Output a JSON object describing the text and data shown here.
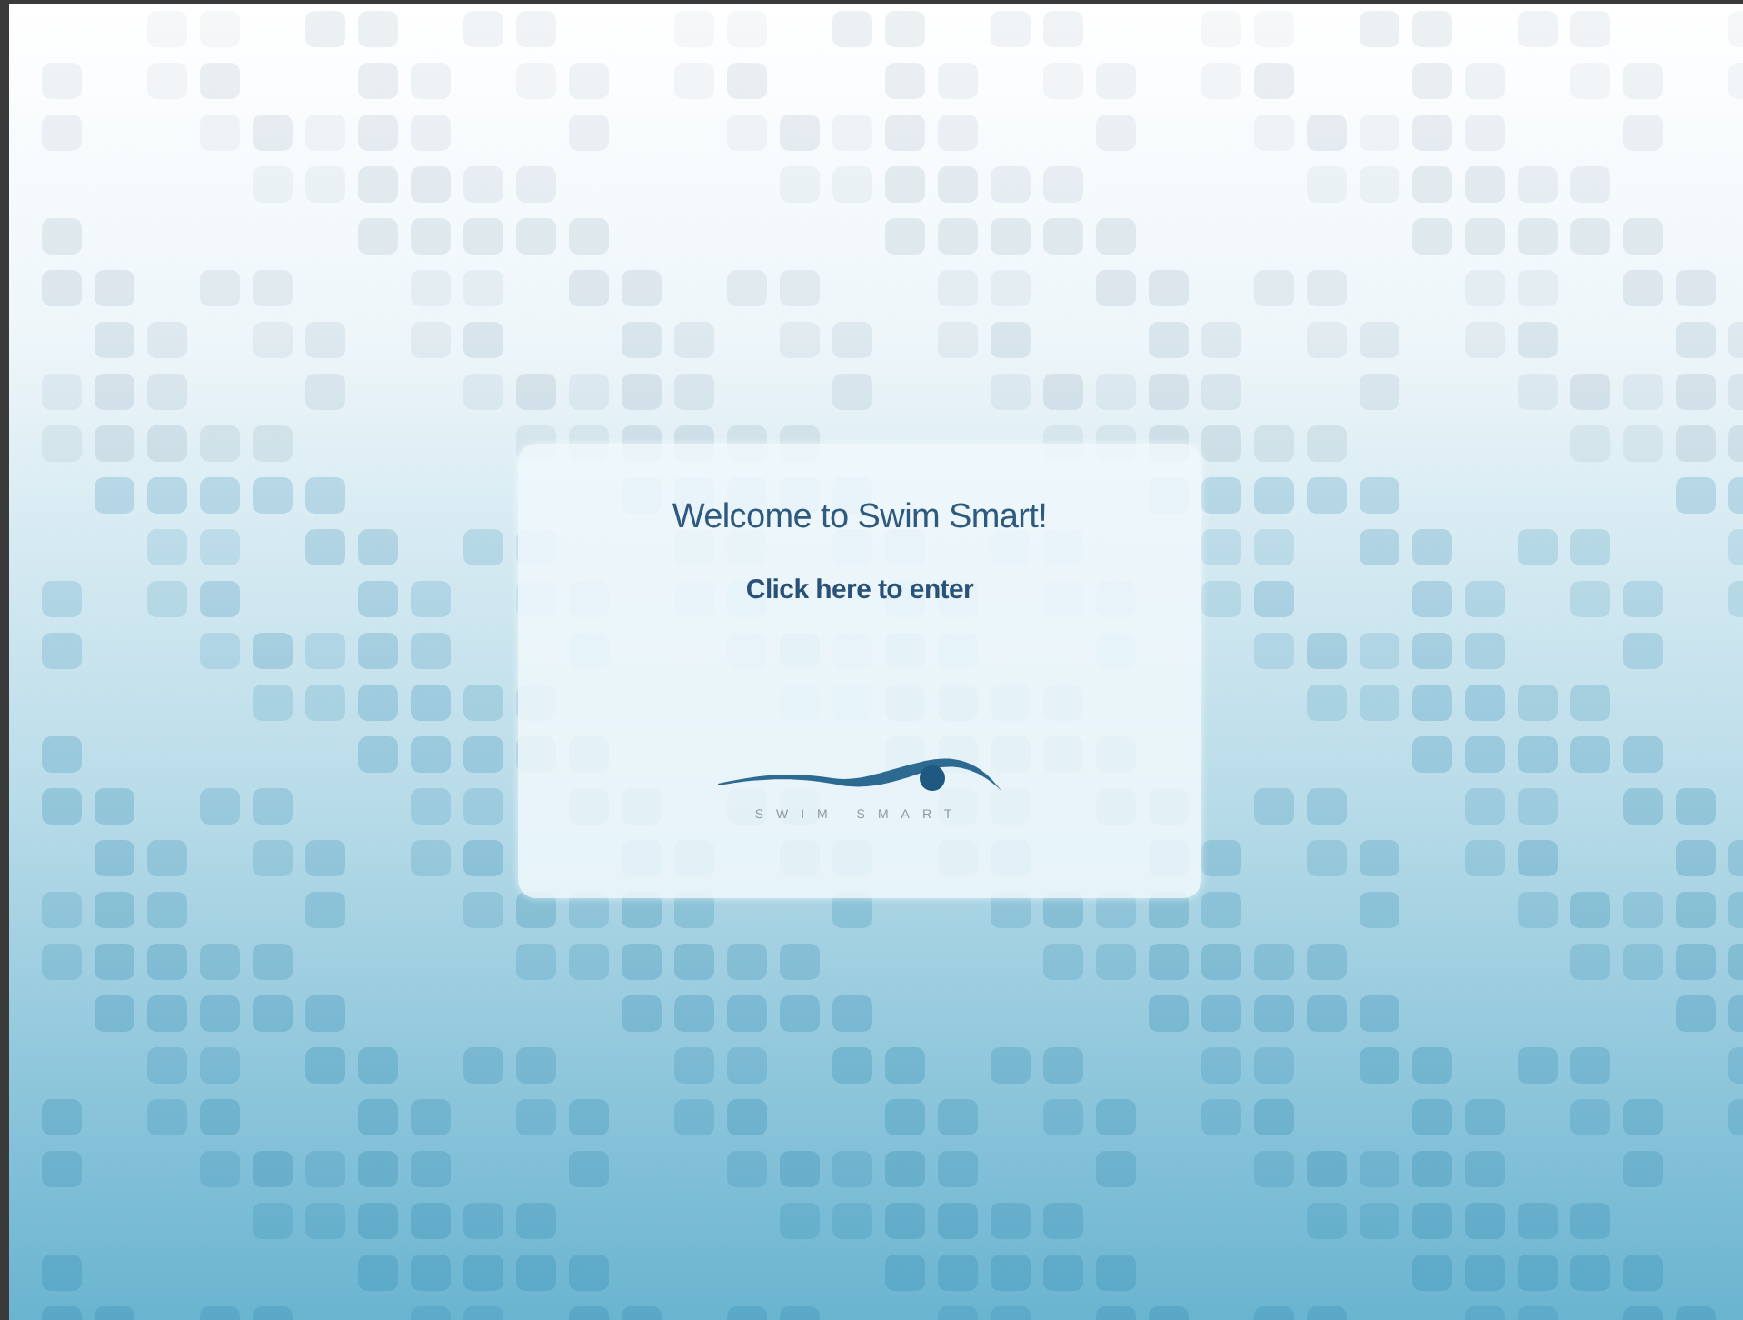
{
  "welcome": {
    "title": "Welcome to Swim Smart!",
    "enter_link": "Click here to enter",
    "logo_text": "SWIM SMART"
  }
}
